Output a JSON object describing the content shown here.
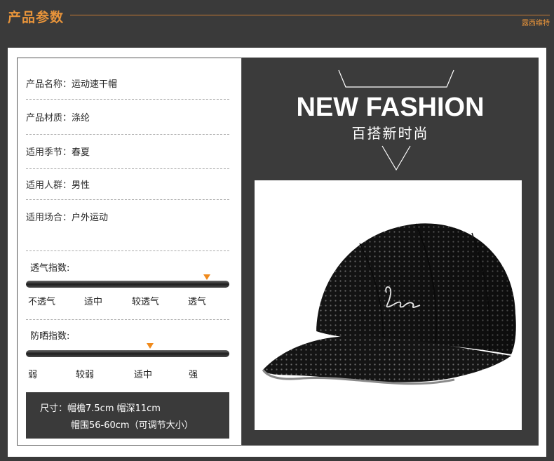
{
  "header": {
    "title": "产品参数",
    "brand": "露西维特"
  },
  "specs": [
    {
      "label": "产品名称：",
      "value": "运动速干帽"
    },
    {
      "label": "产品材质：",
      "value": "涤纶"
    },
    {
      "label": "适用季节：",
      "value": "春夏"
    },
    {
      "label": "适用人群：",
      "value": "男性"
    },
    {
      "label": "适用场合：",
      "value": "户外运动"
    }
  ],
  "breathability": {
    "title": "透气指数:",
    "scale": [
      "不透气",
      "适中",
      "较透气",
      "透气"
    ],
    "level": 0.89
  },
  "sun_protection": {
    "title": "防晒指数:",
    "scale": [
      "弱",
      "较弱",
      "适中",
      "强"
    ],
    "level": 0.61
  },
  "size": {
    "line1": "尺寸：帽檐7.5cm   帽深11cm",
    "line2": "帽围56-60cm（可调节大小）"
  },
  "promo": {
    "title": "NEW FASHION",
    "subtitle": "百搭新时尚"
  },
  "colors": {
    "accent": "#e8943a",
    "marker": "#f08a1c",
    "dark_panel": "#3b3b3b"
  }
}
